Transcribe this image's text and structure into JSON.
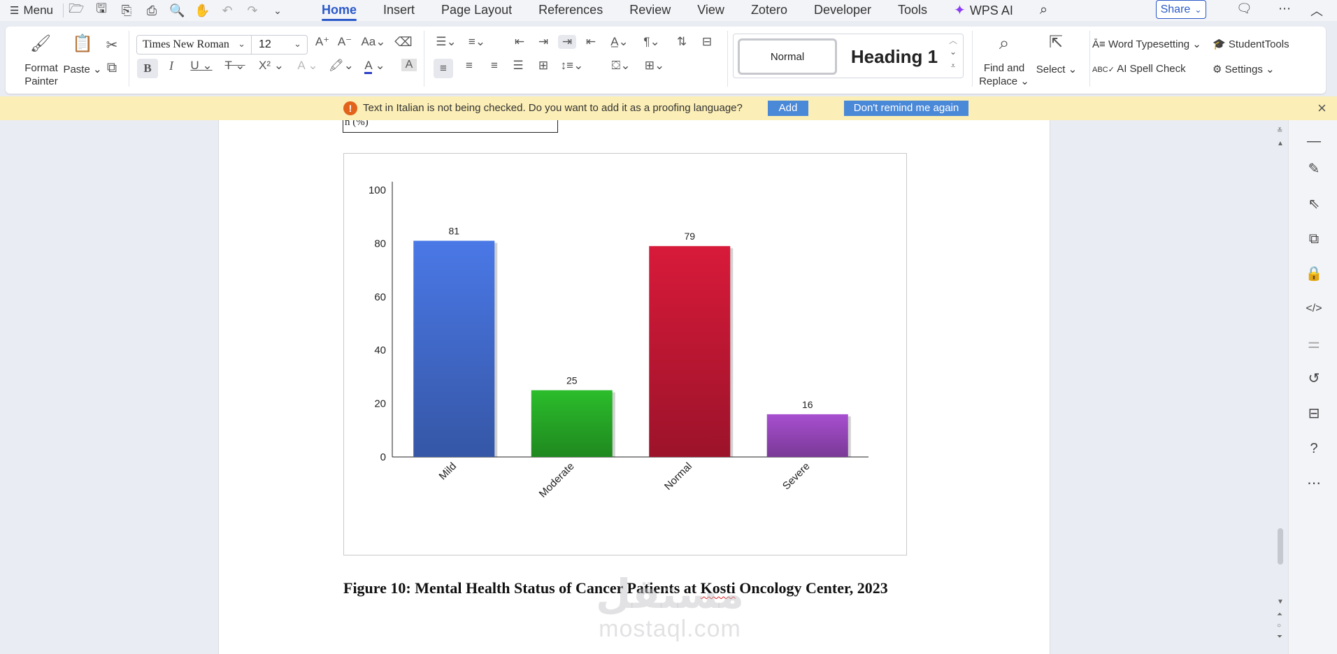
{
  "topbar": {
    "menu_label": "Menu",
    "tabs": [
      "Home",
      "Insert",
      "Page Layout",
      "References",
      "Review",
      "View",
      "Zotero",
      "Developer",
      "Tools"
    ],
    "ai_tab": "WPS AI",
    "share_label": "Share"
  },
  "ribbon": {
    "format_painter": "Format Painter",
    "paste": "Paste",
    "font_name": "Times New Roman",
    "font_size": "12",
    "style_normal": "Normal",
    "style_heading1": "Heading 1",
    "find_replace": "Find and Replace",
    "select": "Select",
    "word_typesetting": "Word Typesetting",
    "ai_spell_check": "AI Spell Check",
    "student_tools": "StudentTools",
    "settings": "Settings"
  },
  "notice": {
    "text": "Text in Italian is not being checked. Do you want to add it as a proofing language?",
    "add_label": "Add",
    "remind_label": "Don't remind me again"
  },
  "document": {
    "table_fragment": "n (%)",
    "caption_before": "Figure 10: Mental Health Status of Cancer Patients at ",
    "caption_kosti": "Kosti",
    "caption_after": " Oncology Center, 2023"
  },
  "watermark": {
    "arabic": "مستقل",
    "latin": "mostaql.com"
  },
  "chart_data": {
    "type": "bar",
    "categories": [
      "Mild",
      "Moderate",
      "Normal",
      "Severe"
    ],
    "values": [
      81,
      25,
      79,
      16
    ],
    "colors": [
      "#4a78e6",
      "#2bbd2b",
      "#d81a3a",
      "#a84fd0"
    ],
    "ylim": [
      0,
      100
    ],
    "yticks": [
      0,
      20,
      40,
      60,
      80,
      100
    ],
    "title": "",
    "xlabel": "",
    "ylabel": "",
    "grid": false
  }
}
